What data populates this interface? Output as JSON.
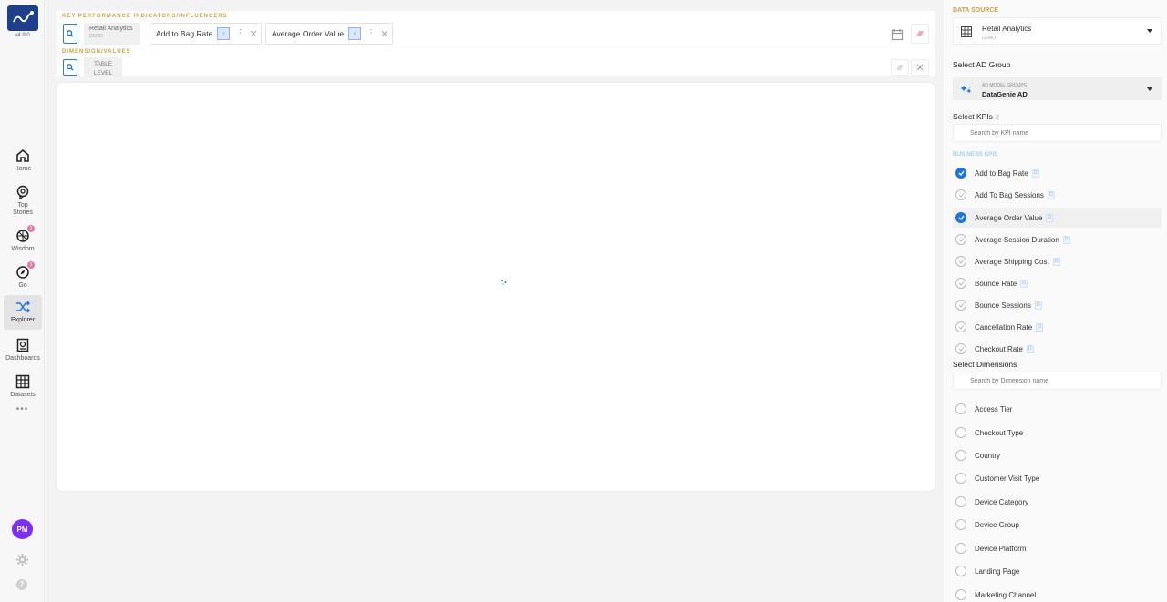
{
  "app": {
    "version": "v4.9.0"
  },
  "nav": {
    "items": [
      {
        "label": "Home"
      },
      {
        "label": "Top Stories"
      },
      {
        "label": "Wisdom",
        "badge": "1"
      },
      {
        "label": "Go",
        "badge": "1"
      },
      {
        "label": "Explorer"
      },
      {
        "label": "Dashboards"
      },
      {
        "label": "Datasets"
      }
    ],
    "more": "•••",
    "user_initials": "PM"
  },
  "kpi_section": {
    "label": "KEY PERFORMANCE INDICATORS/INFLUENCERS",
    "datasource_name": "Retail Analytics",
    "datasource_sub": "DEMO",
    "chips": [
      {
        "label": "Add to Bag Rate",
        "code": "x"
      },
      {
        "label": "Average Order Value",
        "code": "x"
      }
    ]
  },
  "dimension_section": {
    "label": "DIMENSION/VALUES",
    "tag_line1": "TABLE",
    "tag_line2": "LEVEL"
  },
  "panel": {
    "datasource_header": "DATA SOURCE",
    "datasource_name": "Retail Analytics",
    "datasource_sub": "DEMO",
    "ad_group_title": "Select AD Group",
    "ad_group_caption": "AD MODEL GROUPS",
    "ad_group_value": "DataGenie AD",
    "kpis_title": "Select KPIs",
    "kpis_count": "2",
    "kpi_search_placeholder": "Search by KPI name",
    "business_label": "BUSINESS KPIs",
    "kpis": [
      {
        "name": "Add to Bag Rate",
        "code": "D",
        "checked": true
      },
      {
        "name": "Add To Bag Sessions",
        "code": "D",
        "checked": false
      },
      {
        "name": "Average Order Value",
        "code": "D",
        "checked": true
      },
      {
        "name": "Average Session Duration",
        "code": "D",
        "checked": false
      },
      {
        "name": "Average Shipping Cost",
        "code": "D",
        "checked": false
      },
      {
        "name": "Bounce Rate",
        "code": "D",
        "checked": false
      },
      {
        "name": "Bounce Sessions",
        "code": "D",
        "checked": false
      },
      {
        "name": "Cancellation Rate",
        "code": "D",
        "checked": false
      },
      {
        "name": "Checkout Rate",
        "code": "D",
        "checked": false
      }
    ],
    "dimensions_title": "Select Dimensions",
    "dim_search_placeholder": "Search by Dimension name",
    "dimensions": [
      "Access Tier",
      "Checkout Type",
      "Country",
      "Customer Visit Type",
      "Device Category",
      "Device Group",
      "Device Platform",
      "Landing Page",
      "Marketing Channel"
    ]
  },
  "colors": {
    "accent": "#1a73e8",
    "label_gold": "#d0a141",
    "brand": "#1d3f8c",
    "avatar": "#7b2ff7"
  }
}
